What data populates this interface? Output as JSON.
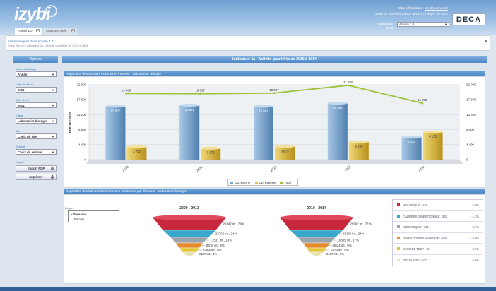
{
  "header": {
    "logo": "izybi",
    "info_line1_prefix": "Votre information : ",
    "info_line1_link": "Me déconnecter",
    "info_line2_prefix": "Base de Données DECA Sèvre | ",
    "info_line2_link": "Changer de base",
    "dashboard_label": "Tableau de bord",
    "dashboard_value": "Activité 1.0",
    "brand": "DECA"
  },
  "tabs": [
    {
      "label": "Activité 1.0"
    },
    {
      "label": "Analyse croisée"
    }
  ],
  "breadcrumb": {
    "title": "Vous naviguez dans Activité 1.0",
    "path": "Vous êtes ici : Indicateur 4a - Activité quantifiée de 2010 à 2014"
  },
  "sidebar": {
    "title": "Options",
    "filters": [
      {
        "label": "Unité d'affichage",
        "value": "Année"
      },
      {
        "label": "Date de début",
        "value": "2010"
      },
      {
        "label": "Date de fin",
        "value": "2014"
      },
      {
        "label": "Client",
        "value": "Laboratoire biologie"
      },
      {
        "label": "Site",
        "value": "Choix du site"
      },
      {
        "label": "Service",
        "value": "Choix du service"
      }
    ],
    "export_label": "Export",
    "export_pdf": "Export PDF",
    "print": "Imprimer"
  },
  "main": {
    "title": "Indicateur 4a - Activité quantifiée de 2010 à 2014",
    "section1": "Répartition des activités externes et internes - Laboratoire biologie",
    "section2": "Répartition des interventions externes et internes par domaine - Laboratoire biologie"
  },
  "chart_data": [
    {
      "type": "bar",
      "categories": [
        "2010",
        "2011",
        "2012",
        "2013",
        "2014"
      ],
      "ylabel": "Interventions",
      "ylim": [
        0,
        22000
      ],
      "yticks": [
        "22 000",
        "17 600",
        "13 200",
        "8 800",
        "4 400",
        "0"
      ],
      "series": [
        {
          "name": "Op. interne",
          "values": [
            15687,
            15991,
            15681,
            16593,
            6642
          ],
          "labels": [
            "15 687",
            "15 991",
            "15 681",
            "16 593",
            "6 642"
          ],
          "color": "#7fa9cf"
        },
        {
          "name": "Op. externe",
          "values": [
            3752,
            3376,
            3873,
            5235,
            8153
          ],
          "labels": [
            "3 752",
            "3 376",
            "3 873",
            "5 235",
            "8 153"
          ],
          "color": "#e2c04a"
        },
        {
          "name": "Total",
          "values": [
            19439,
            19367,
            19557,
            21828,
            16595
          ],
          "labels": [
            "19 439",
            "19 367",
            "19 557",
            "21 828",
            "16 595"
          ],
          "color": "#9cc43a"
        }
      ],
      "legend": "bottom"
    },
    {
      "type": "funnel",
      "title": "2009 - 2013",
      "labels": [
        "29147 int., 39%",
        "23706 int., 24%",
        "17531 int., 18%",
        "8678 int., 9%",
        "5464 int., 6%",
        "3187 int., 3%"
      ]
    },
    {
      "type": "funnel",
      "title": "2010 - 2014",
      "labels": [
        "29962 int., 31%",
        "23424 int., 24%",
        "16885 int., 17%",
        "8624 int., 9%",
        "5419 int., 6%",
        "3407 int., 3%"
      ]
    }
  ],
  "domain_filter": {
    "title": "Degré",
    "items": [
      "Domaine",
      "Famille"
    ]
  },
  "domain_table": [
    {
      "name": "MECANIQUE: -815",
      "pct": "2.8%",
      "color": "#c8283c"
    },
    {
      "name": "CALIBRES DIMENTIONNEL: -282",
      "pct": "-1.2%",
      "color": "#3aa8cc"
    },
    {
      "name": "ELECTRIQUE: -646",
      "pct": "-3.7%",
      "color": "#9aa4ae"
    },
    {
      "name": "DIMENTIONNEL VARIABLE: -294",
      "pct": "-3.8%",
      "color": "#e58a2a"
    },
    {
      "name": "BANC DE TEST: -45",
      "pct": "-0.8%",
      "color": "#e3c63a"
    },
    {
      "name": "OUTILLAGE: +210",
      "pct": "6.6%",
      "color": "#e8e0b0"
    }
  ]
}
